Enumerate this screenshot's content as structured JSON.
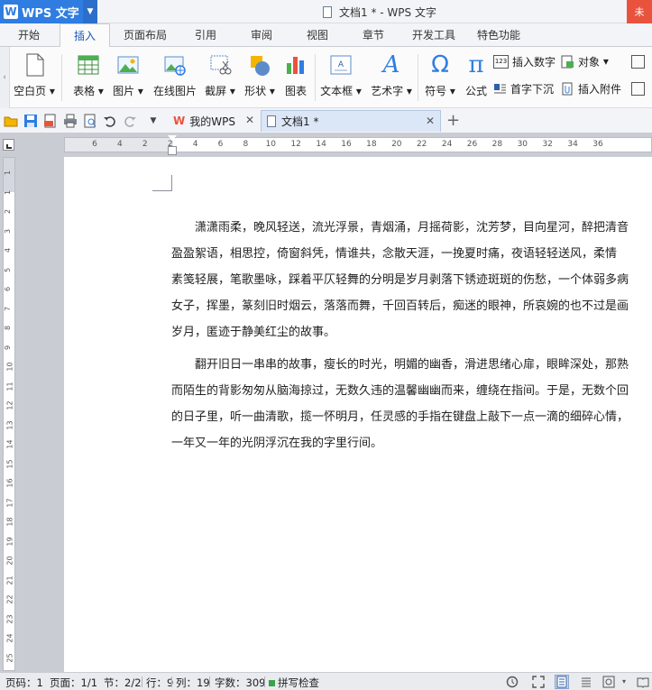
{
  "titlebar": {
    "app_name": "WPS 文字",
    "window_title": "文档1 * - WPS 文字"
  },
  "menu_tabs": [
    {
      "label": "开始"
    },
    {
      "label": "插入",
      "active": true
    },
    {
      "label": "页面布局"
    },
    {
      "label": "引用"
    },
    {
      "label": "审阅"
    },
    {
      "label": "视图"
    },
    {
      "label": "章节"
    },
    {
      "label": "开发工具"
    },
    {
      "label": "特色功能"
    }
  ],
  "ribbon": {
    "blank_page": "空白页",
    "table": "表格",
    "picture": "图片",
    "online_picture": "在线图片",
    "screenshot": "截屏",
    "shapes": "形状",
    "chart": "图表",
    "textbox": "文本框",
    "wordart": "艺术字",
    "symbol": "符号",
    "formula": "公式",
    "insert_number": "插入数字",
    "object": "对象",
    "drop_cap": "首字下沉",
    "insert_attachment": "插入附件",
    "sym_omega": "Ω",
    "sym_pi": "π",
    "sym_A": "A",
    "num_badge": "123"
  },
  "quickbar": {
    "tab_mywps": "我的WPS",
    "tab_doc": "文档1 *"
  },
  "ruler": {
    "h_ticks": [
      "6",
      "4",
      "2",
      "2",
      "4",
      "6",
      "8",
      "10",
      "12",
      "14",
      "16",
      "18",
      "20",
      "22",
      "24",
      "26",
      "28",
      "30",
      "32",
      "34",
      "36"
    ],
    "v_ticks": [
      "1",
      "1",
      "2",
      "3",
      "4",
      "5",
      "6",
      "7",
      "8",
      "9",
      "10",
      "11",
      "12",
      "13",
      "14",
      "15",
      "16",
      "17",
      "18",
      "19",
      "20",
      "21",
      "22",
      "23",
      "24",
      "25"
    ]
  },
  "document": {
    "paragraph1": [
      "　　潇潇雨柔，晚风轻送，流光浮景，青烟涌，月摇荷影，沈芳梦，目向星河，醉把清音",
      "盈盈絮语，相思控，倚窗斜凭，情谁共，念散天涯，一挽夏时痛，夜语轻轻送风，柔情",
      "素笺轻展，笔歌墨咏，踩着平仄轻舞的分明是岁月剥落下锈迹斑斑的伤愁，一个体弱多病",
      "女子，挥墨，篆刻旧时烟云，落落而舞，千回百转后，痴迷的眼神，所哀婉的也不过是画",
      "岁月，匿迹于静美红尘的故事。"
    ],
    "paragraph2": [
      "　　翻开旧日一串串的故事，瘦长的时光，明媚的幽香，滑进思绪心扉，眼眸深处，那熟",
      "而陌生的背影匆匆从脑海掠过，无数久违的温馨幽幽而来，缠绕在指间。于是，无数个回",
      "的日子里，听一曲清歌，揽一怀明月，任灵感的手指在键盘上敲下一点一滴的细碎心情，",
      "一年又一年的光阴浮沉在我的字里行间。"
    ]
  },
  "statusbar": {
    "page_num": "页码：1",
    "pages": "页面：1/1",
    "section": "节：2/2",
    "row": "行：9",
    "col": "列：19",
    "word_count": "字数：309",
    "spell_check": "拼写检查"
  },
  "colors": {
    "accent": "#2f7de1",
    "close": "#e9533d",
    "spell_ok": "#3aa24a"
  }
}
